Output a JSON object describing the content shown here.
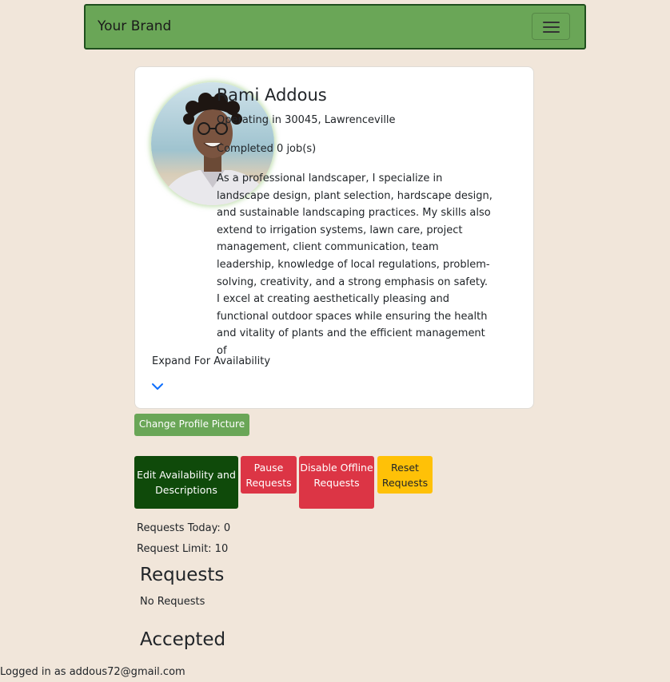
{
  "navbar": {
    "brand": "Your Brand",
    "toggle_icon": "hamburger-menu-icon"
  },
  "profile": {
    "name": "Rami Addous",
    "location": "Operating in 30045, Lawrenceville",
    "completed": "Completed 0 job(s)",
    "bio": "As a professional landscaper, I specialize in landscape design, plant selection, hardscape design, and sustainable landscaping practices. My skills also extend to irrigation systems, lawn care, project management, client communication, team leadership, knowledge of local regulations, problem-solving, creativity, and a strong emphasis on safety. I excel at creating aesthetically pleasing and functional outdoor spaces while ensuring the health and vitality of plants and the efficient management of",
    "expand_label": "Expand For Availability",
    "expand_icon": "chevron-down-icon"
  },
  "actions": {
    "change_picture": "Change Profile Picture",
    "edit_availability": "Edit Availability and Descriptions",
    "pause_requests": "Pause Requests",
    "disable_offline": "Disable Offline Requests",
    "reset_requests": "Reset Requests"
  },
  "stats": {
    "requests_today": "Requests Today: 0",
    "request_limit": "Request Limit: 10"
  },
  "requests": {
    "title": "Requests",
    "empty": "No Requests"
  },
  "accepted": {
    "title": "Accepted"
  },
  "footer": {
    "logged_in": "Logged in as addous72@gmail.com"
  },
  "colors": {
    "background": "#f1e6da",
    "navbar": "#6aa657",
    "dark_green": "#0f4a0a",
    "danger": "#dc3545",
    "warning": "#ffc107"
  }
}
